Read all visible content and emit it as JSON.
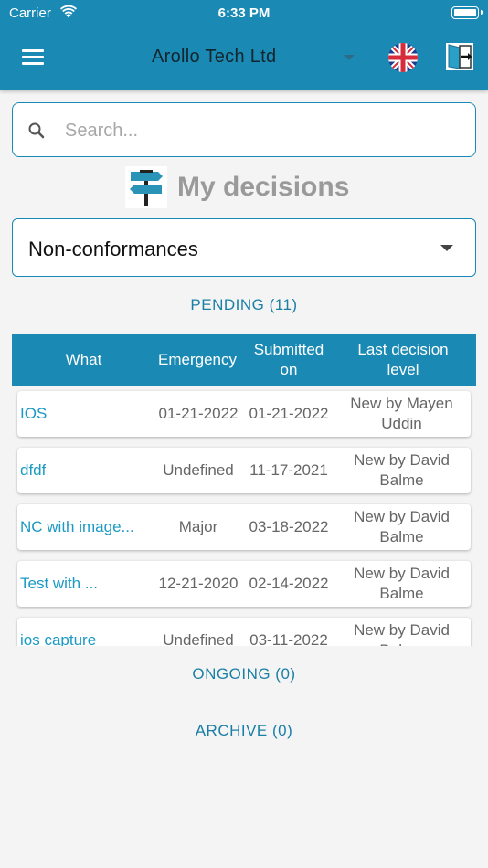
{
  "status_bar": {
    "carrier": "Carrier",
    "time": "6:33 PM"
  },
  "header": {
    "company": "Arollo Tech Ltd",
    "icons": {
      "menu": "hamburger-menu-icon",
      "language": "uk-flag-icon",
      "logout": "exit-door-icon"
    }
  },
  "search": {
    "placeholder": "Search..."
  },
  "page": {
    "title": "My decisions"
  },
  "category_select": {
    "value": "Non-conformances"
  },
  "sections": {
    "pending": "PENDING (11)",
    "ongoing": "ONGOING (0)",
    "archive": "ARCHIVE (0)"
  },
  "table": {
    "headers": {
      "what": "What",
      "emergency": "Emergency",
      "submitted": "Submitted on",
      "level": "Last decision level"
    },
    "rows": [
      {
        "what": "IOS",
        "emergency": "01-21-2022",
        "submitted": "01-21-2022",
        "level": "New by Mayen Uddin"
      },
      {
        "what": "dfdf",
        "emergency": "Undefined",
        "submitted": "11-17-2021",
        "level": "New by David Balme"
      },
      {
        "what": "NC with image...",
        "emergency": "Major",
        "submitted": "03-18-2022",
        "level": "New by David Balme"
      },
      {
        "what": "Test with ...",
        "emergency": "12-21-2020",
        "submitted": "02-14-2022",
        "level": "New by David Balme"
      },
      {
        "what": "ios capture",
        "emergency": "Undefined",
        "submitted": "03-11-2022",
        "level": "New by David Balme"
      }
    ]
  },
  "colors": {
    "brand": "#1a8ab4",
    "link": "#1a9ac4",
    "background": "#f4f4f4"
  }
}
